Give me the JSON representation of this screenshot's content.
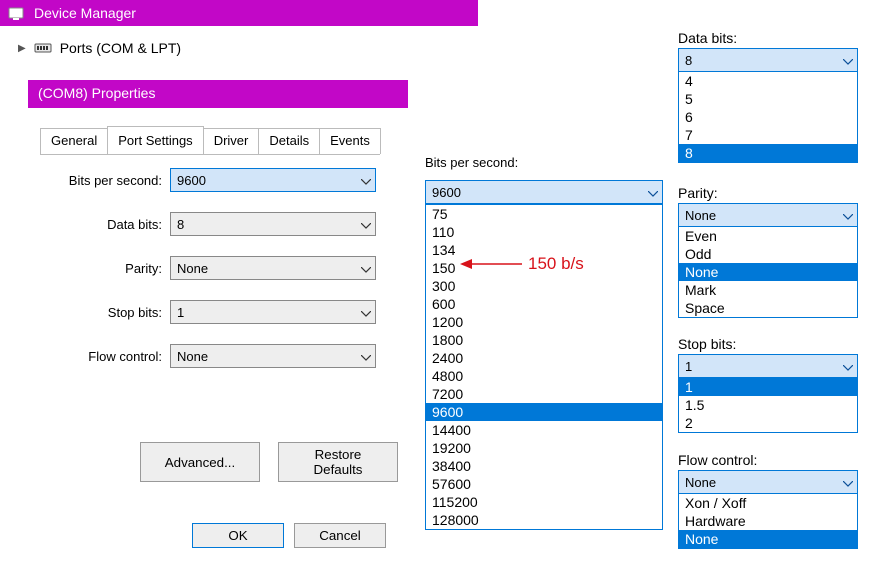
{
  "header": {
    "title": "Device Manager"
  },
  "tree": {
    "ports_label": "Ports (COM & LPT)"
  },
  "prop": {
    "title": "(COM8) Properties",
    "tabs": [
      "General",
      "Port Settings",
      "Driver",
      "Details",
      "Events"
    ],
    "active_tab_index": 1
  },
  "form": {
    "bps": {
      "label": "Bits per second:",
      "value": "9600"
    },
    "databits": {
      "label": "Data bits:",
      "value": "8"
    },
    "parity": {
      "label": "Parity:",
      "value": "None"
    },
    "stopbits": {
      "label": "Stop bits:",
      "value": "1"
    },
    "flow": {
      "label": "Flow control:",
      "value": "None"
    },
    "advanced_btn": "Advanced...",
    "restore_btn": "Restore Defaults",
    "ok": "OK",
    "cancel": "Cancel"
  },
  "bps_dropdown": {
    "label": "Bits per second:",
    "selected": "9600",
    "options": [
      "75",
      "110",
      "134",
      "150",
      "300",
      "600",
      "1200",
      "1800",
      "2400",
      "4800",
      "7200",
      "9600",
      "14400",
      "19200",
      "38400",
      "57600",
      "115200",
      "128000"
    ],
    "highlight": "9600"
  },
  "annotation": {
    "text": "150 b/s"
  },
  "databits_dd": {
    "label": "Data bits:",
    "selected": "8",
    "options": [
      "4",
      "5",
      "6",
      "7",
      "8"
    ],
    "highlight": "8"
  },
  "parity_dd": {
    "label": "Parity:",
    "selected": "None",
    "options": [
      "Even",
      "Odd",
      "None",
      "Mark",
      "Space"
    ],
    "highlight": "None"
  },
  "stopbits_dd": {
    "label": "Stop bits:",
    "selected": "1",
    "options": [
      "1",
      "1.5",
      "2"
    ],
    "highlight": "1"
  },
  "flow_dd": {
    "label": "Flow control:",
    "selected": "None",
    "options": [
      "Xon / Xoff",
      "Hardware",
      "None"
    ],
    "highlight": "None"
  }
}
